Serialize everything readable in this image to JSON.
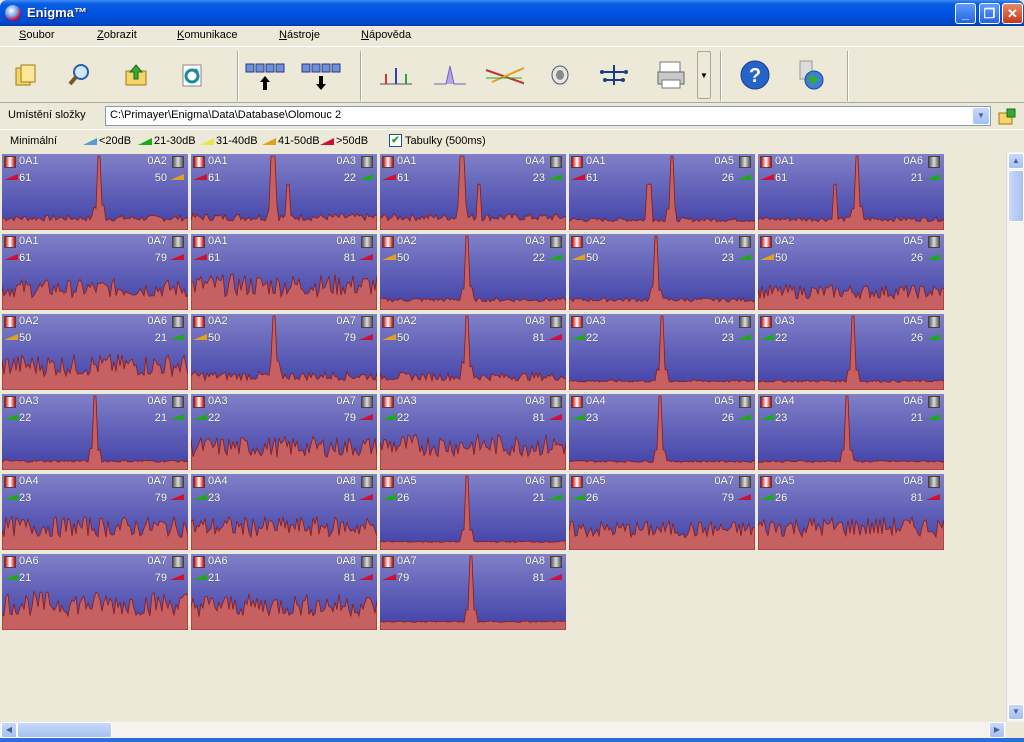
{
  "window": {
    "title": "Enigma™"
  },
  "menu": [
    "Soubor",
    "Zobrazit",
    "Komunikace",
    "Nástroje",
    "Nápověda"
  ],
  "toolbar": {
    "icons": [
      "open-folder-icon",
      "search-icon",
      "folder-up-icon",
      "refresh-icon",
      "upload-icon",
      "download-icon",
      "spectrum-icon",
      "spectrum-single-icon",
      "correlation-icon",
      "speaker-icon",
      "network-icon",
      "print-icon",
      "help-icon",
      "globe-icon"
    ]
  },
  "address": {
    "label": "Umístění složky",
    "value": "C:\\Primayer\\Enigma\\Data\\Database\\Olomouc 2"
  },
  "legend": {
    "title": "Minimální",
    "items": [
      {
        "label": "<20dB",
        "color": "#5b9bd5"
      },
      {
        "label": "21-30dB",
        "color": "#1aaa1a"
      },
      {
        "label": "31-40dB",
        "color": "#e6e64a"
      },
      {
        "label": "41-50dB",
        "color": "#e0a020"
      },
      {
        "label": ">50dB",
        "color": "#cc1133"
      }
    ],
    "checkbox_label": "Tabulky (500ms)",
    "checked": true
  },
  "cells": [
    {
      "a": "0A1",
      "av": "61",
      "ac": "#cc1133",
      "b": "0A2",
      "bv": "50",
      "bc": "#e0a020",
      "peak": 0.52,
      "noise": 0.15,
      "pk2": 0
    },
    {
      "a": "0A1",
      "av": "61",
      "ac": "#cc1133",
      "b": "0A3",
      "bv": "22",
      "bc": "#1aaa1a",
      "peak": 0.44,
      "noise": 0.18,
      "pk2": 0.52
    },
    {
      "a": "0A1",
      "av": "61",
      "ac": "#cc1133",
      "b": "0A4",
      "bv": "23",
      "bc": "#1aaa1a",
      "peak": 0.44,
      "noise": 0.18,
      "pk2": 0.53
    },
    {
      "a": "0A1",
      "av": "61",
      "ac": "#cc1133",
      "b": "0A5",
      "bv": "26",
      "bc": "#1aaa1a",
      "peak": 0.55,
      "noise": 0.1,
      "pk2": 0.43
    },
    {
      "a": "0A1",
      "av": "61",
      "ac": "#cc1133",
      "b": "0A6",
      "bv": "21",
      "bc": "#1aaa1a",
      "peak": 0.53,
      "noise": 0.12,
      "pk2": 0.41
    },
    {
      "a": "0A1",
      "av": "61",
      "ac": "#cc1133",
      "b": "0A7",
      "bv": "79",
      "bc": "#cc1133",
      "peak": 0,
      "noise": 0.45,
      "pk2": 0
    },
    {
      "a": "0A1",
      "av": "61",
      "ac": "#cc1133",
      "b": "0A8",
      "bv": "81",
      "bc": "#cc1133",
      "peak": 0,
      "noise": 0.55,
      "pk2": 0
    },
    {
      "a": "0A2",
      "av": "50",
      "ac": "#e0a020",
      "b": "0A3",
      "bv": "22",
      "bc": "#1aaa1a",
      "peak": 0.47,
      "noise": 0.1,
      "pk2": 0
    },
    {
      "a": "0A2",
      "av": "50",
      "ac": "#e0a020",
      "b": "0A4",
      "bv": "23",
      "bc": "#1aaa1a",
      "peak": 0.47,
      "noise": 0.1,
      "pk2": 0
    },
    {
      "a": "0A2",
      "av": "50",
      "ac": "#e0a020",
      "b": "0A5",
      "bv": "26",
      "bc": "#1aaa1a",
      "peak": 0,
      "noise": 0.35,
      "pk2": 0
    },
    {
      "a": "0A2",
      "av": "50",
      "ac": "#e0a020",
      "b": "0A6",
      "bv": "21",
      "bc": "#1aaa1a",
      "peak": 0,
      "noise": 0.55,
      "pk2": 0
    },
    {
      "a": "0A2",
      "av": "50",
      "ac": "#e0a020",
      "b": "0A7",
      "bv": "79",
      "bc": "#cc1133",
      "peak": 0.45,
      "noise": 0.22,
      "pk2": 0
    },
    {
      "a": "0A2",
      "av": "50",
      "ac": "#e0a020",
      "b": "0A8",
      "bv": "81",
      "bc": "#cc1133",
      "peak": 0.47,
      "noise": 0.2,
      "pk2": 0
    },
    {
      "a": "0A3",
      "av": "22",
      "ac": "#1aaa1a",
      "b": "0A4",
      "bv": "23",
      "bc": "#1aaa1a",
      "peak": 0.5,
      "noise": 0.06,
      "pk2": 0
    },
    {
      "a": "0A3",
      "av": "22",
      "ac": "#1aaa1a",
      "b": "0A5",
      "bv": "26",
      "bc": "#1aaa1a",
      "peak": 0.51,
      "noise": 0.06,
      "pk2": 0
    },
    {
      "a": "0A3",
      "av": "22",
      "ac": "#1aaa1a",
      "b": "0A6",
      "bv": "21",
      "bc": "#1aaa1a",
      "peak": 0.5,
      "noise": 0.06,
      "pk2": 0
    },
    {
      "a": "0A3",
      "av": "22",
      "ac": "#1aaa1a",
      "b": "0A7",
      "bv": "79",
      "bc": "#cc1133",
      "peak": 0,
      "noise": 0.5,
      "pk2": 0
    },
    {
      "a": "0A3",
      "av": "22",
      "ac": "#1aaa1a",
      "b": "0A8",
      "bv": "81",
      "bc": "#cc1133",
      "peak": 0,
      "noise": 0.55,
      "pk2": 0
    },
    {
      "a": "0A4",
      "av": "23",
      "ac": "#1aaa1a",
      "b": "0A5",
      "bv": "26",
      "bc": "#1aaa1a",
      "peak": 0.49,
      "noise": 0.05,
      "pk2": 0
    },
    {
      "a": "0A4",
      "av": "23",
      "ac": "#1aaa1a",
      "b": "0A6",
      "bv": "21",
      "bc": "#1aaa1a",
      "peak": 0.48,
      "noise": 0.05,
      "pk2": 0
    },
    {
      "a": "0A4",
      "av": "23",
      "ac": "#1aaa1a",
      "b": "0A7",
      "bv": "79",
      "bc": "#cc1133",
      "peak": 0,
      "noise": 0.5,
      "pk2": 0
    },
    {
      "a": "0A4",
      "av": "23",
      "ac": "#1aaa1a",
      "b": "0A8",
      "bv": "81",
      "bc": "#cc1133",
      "peak": 0,
      "noise": 0.5,
      "pk2": 0
    },
    {
      "a": "0A5",
      "av": "26",
      "ac": "#1aaa1a",
      "b": "0A6",
      "bv": "21",
      "bc": "#1aaa1a",
      "peak": 0.47,
      "noise": 0.04,
      "pk2": 0
    },
    {
      "a": "0A5",
      "av": "26",
      "ac": "#1aaa1a",
      "b": "0A7",
      "bv": "79",
      "bc": "#cc1133",
      "peak": 0,
      "noise": 0.42,
      "pk2": 0
    },
    {
      "a": "0A5",
      "av": "26",
      "ac": "#1aaa1a",
      "b": "0A8",
      "bv": "81",
      "bc": "#cc1133",
      "peak": 0,
      "noise": 0.5,
      "pk2": 0
    },
    {
      "a": "0A6",
      "av": "21",
      "ac": "#1aaa1a",
      "b": "0A7",
      "bv": "79",
      "bc": "#cc1133",
      "peak": 0,
      "noise": 0.6,
      "pk2": 0
    },
    {
      "a": "0A6",
      "av": "21",
      "ac": "#1aaa1a",
      "b": "0A8",
      "bv": "81",
      "bc": "#cc1133",
      "peak": 0,
      "noise": 0.55,
      "pk2": 0
    },
    {
      "a": "0A7",
      "av": "79",
      "ac": "#cc1133",
      "b": "0A8",
      "bv": "81",
      "bc": "#cc1133",
      "peak": 0.49,
      "noise": 0.04,
      "pk2": 0
    }
  ]
}
